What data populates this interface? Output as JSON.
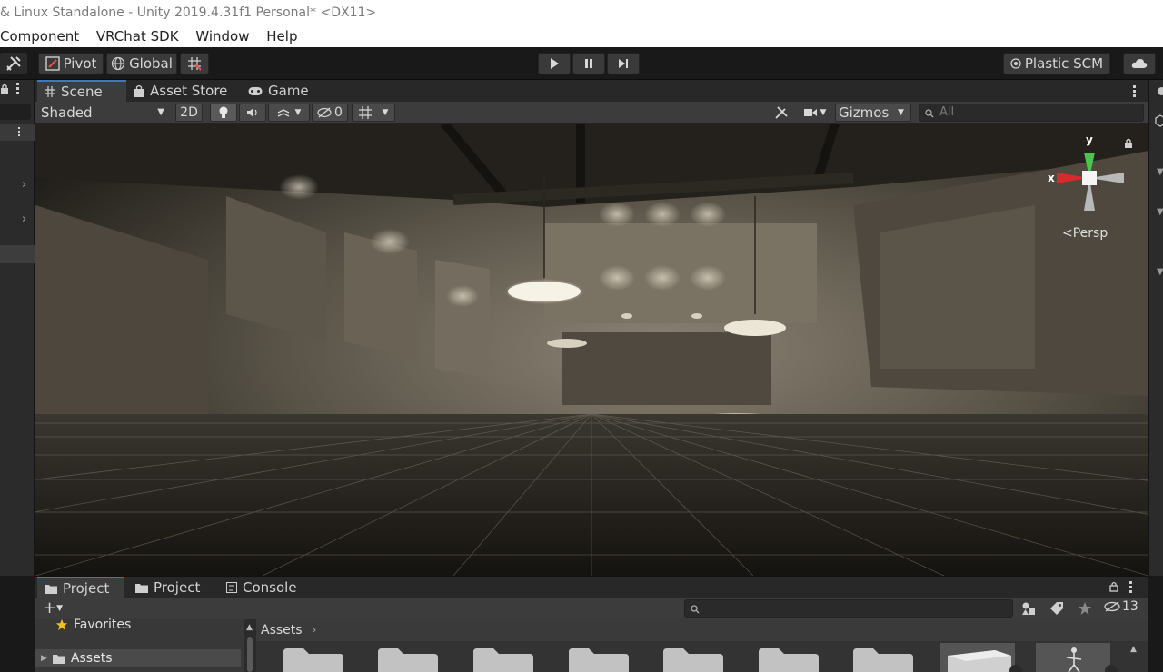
{
  "window": {
    "title": "& Linux Standalone - Unity 2019.4.31f1 Personal* <DX11>"
  },
  "menu": [
    "Component",
    "VRChat SDK",
    "Window",
    "Help"
  ],
  "toolbar": {
    "pivot_label": "Pivot",
    "global_label": "Global",
    "plastic_label": "Plastic SCM"
  },
  "scene_tabs": [
    {
      "label": "Scene",
      "icon": "grid-icon"
    },
    {
      "label": "Asset Store",
      "icon": "bag-icon"
    },
    {
      "label": "Game",
      "icon": "gamepad-icon"
    }
  ],
  "scene_toolbar": {
    "shading_mode": "Shaded",
    "mode_2d": "2D",
    "hidden_count": "0",
    "gizmos_label": "Gizmos",
    "search_placeholder": "All"
  },
  "view": {
    "projection": "Persp",
    "axis_y": "y",
    "axis_x": "x"
  },
  "bottom_tabs": [
    {
      "label": "Project",
      "icon": "folder-icon"
    },
    {
      "label": "Project",
      "icon": "folder-icon"
    },
    {
      "label": "Console",
      "icon": "console-icon"
    }
  ],
  "project": {
    "favorites_label": "Favorites",
    "assets_label": "Assets",
    "breadcrumb": "Assets",
    "hidden_packages_count": "13"
  },
  "colors": {
    "accent": "#3a79bb",
    "axis_x": "#d42b2b",
    "axis_y": "#4ec24e",
    "star": "#f0c020"
  }
}
